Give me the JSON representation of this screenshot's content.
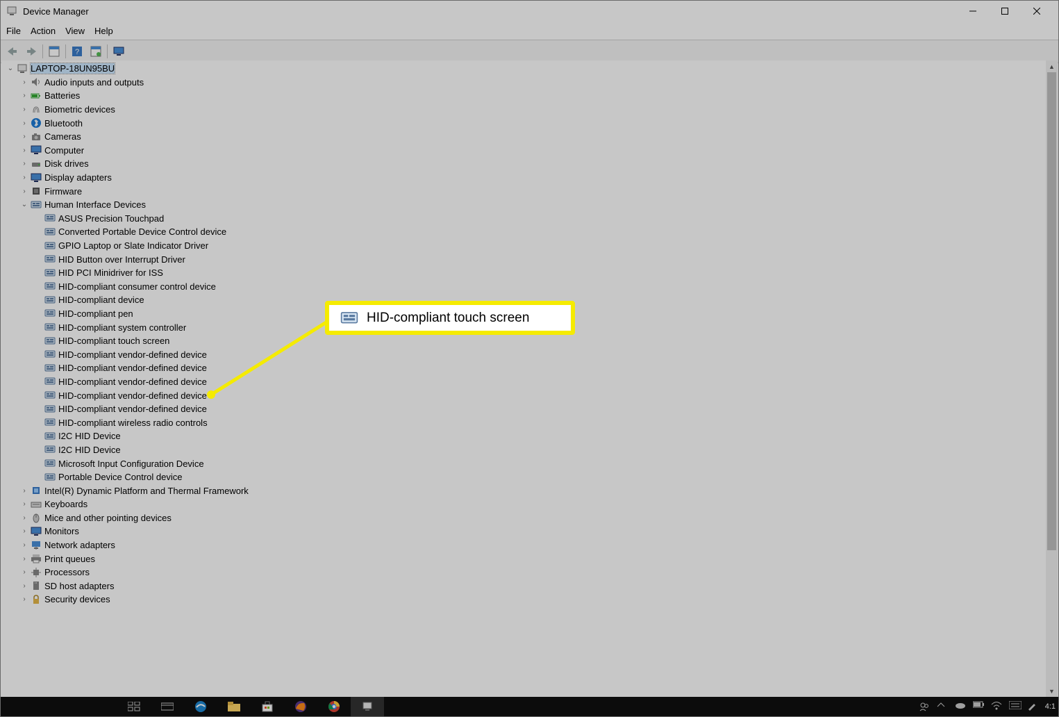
{
  "window": {
    "title": "Device Manager"
  },
  "menu": {
    "file": "File",
    "action": "Action",
    "view": "View",
    "help": "Help"
  },
  "root": {
    "label": "LAPTOP-18UN95BU"
  },
  "categories": [
    {
      "label": "Audio inputs and outputs",
      "icon": "speaker"
    },
    {
      "label": "Batteries",
      "icon": "battery"
    },
    {
      "label": "Biometric devices",
      "icon": "fingerprint"
    },
    {
      "label": "Bluetooth",
      "icon": "bluetooth"
    },
    {
      "label": "Cameras",
      "icon": "camera"
    },
    {
      "label": "Computer",
      "icon": "monitor"
    },
    {
      "label": "Disk drives",
      "icon": "disk"
    },
    {
      "label": "Display adapters",
      "icon": "monitor"
    },
    {
      "label": "Firmware",
      "icon": "chip"
    },
    {
      "label": "Human Interface Devices",
      "icon": "hid",
      "expanded": true,
      "children": [
        "ASUS Precision Touchpad",
        "Converted Portable Device Control device",
        "GPIO Laptop or Slate Indicator Driver",
        "HID Button over Interrupt Driver",
        "HID PCI Minidriver for ISS",
        "HID-compliant consumer control device",
        "HID-compliant device",
        "HID-compliant pen",
        "HID-compliant system controller",
        "HID-compliant touch screen",
        "HID-compliant vendor-defined device",
        "HID-compliant vendor-defined device",
        "HID-compliant vendor-defined device",
        "HID-compliant vendor-defined device",
        "HID-compliant vendor-defined device",
        "HID-compliant wireless radio controls",
        "I2C HID Device",
        "I2C HID Device",
        "Microsoft Input Configuration Device",
        "Portable Device Control device"
      ]
    },
    {
      "label": "Intel(R) Dynamic Platform and Thermal Framework",
      "icon": "chipblu"
    },
    {
      "label": "Keyboards",
      "icon": "keyboard"
    },
    {
      "label": "Mice and other pointing devices",
      "icon": "mouse"
    },
    {
      "label": "Monitors",
      "icon": "monitor"
    },
    {
      "label": "Network adapters",
      "icon": "network"
    },
    {
      "label": "Print queues",
      "icon": "printer"
    },
    {
      "label": "Processors",
      "icon": "cpu"
    },
    {
      "label": "SD host adapters",
      "icon": "sd"
    },
    {
      "label": "Security devices",
      "icon": "security"
    }
  ],
  "callout": {
    "label": "HID-compliant touch screen"
  },
  "clock": "4:1"
}
